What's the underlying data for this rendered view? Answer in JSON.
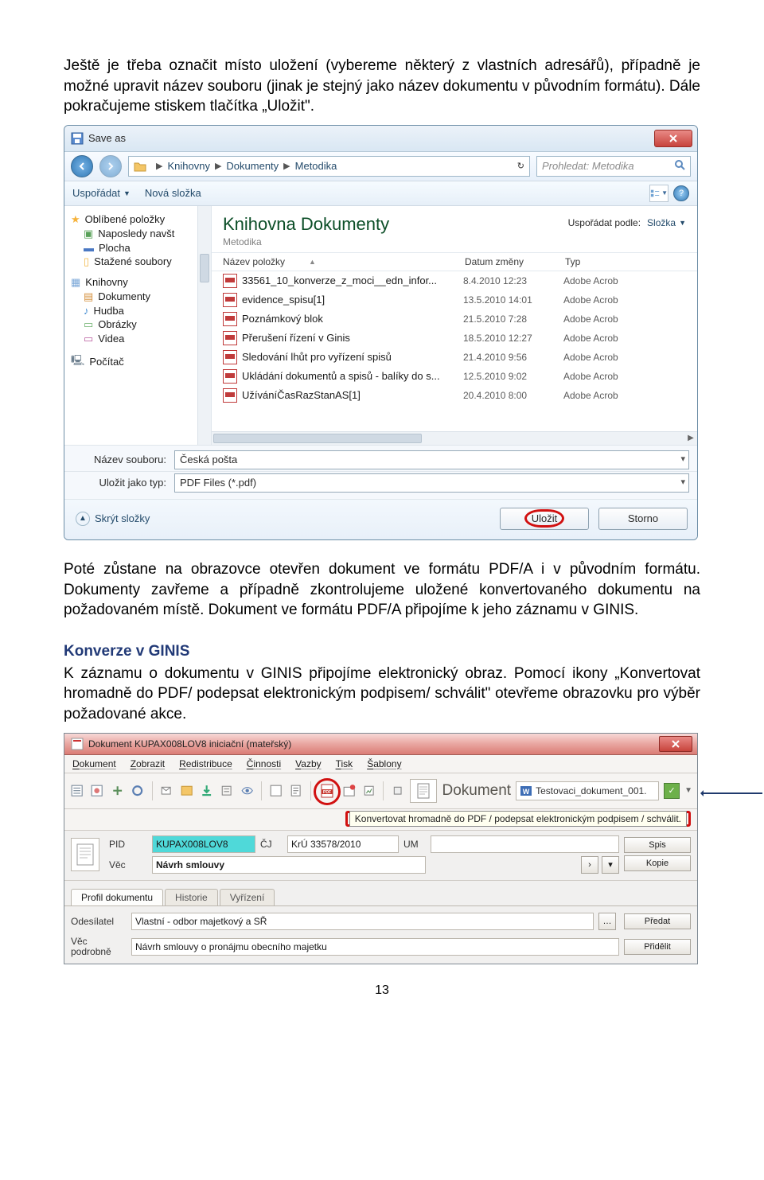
{
  "para1": "Ještě je třeba označit místo uložení (vybereme některý z vlastních adresářů), případně je možné upravit název souboru (jinak je stejný jako název dokumentu v původním formátu). Dále pokračujeme stiskem tlačítka „Uložit\".",
  "saveDialog": {
    "title": "Save as",
    "breadcrumb": [
      "Knihovny",
      "Dokumenty",
      "Metodika"
    ],
    "searchPlaceholder": "Prohledat: Metodika",
    "toolbar": {
      "organize": "Uspořádat",
      "newFolder": "Nová složka"
    },
    "nav": {
      "favorites": {
        "label": "Oblíbené položky",
        "items": [
          "Naposledy navšt",
          "Plocha",
          "Stažené soubory"
        ]
      },
      "libraries": {
        "label": "Knihovny",
        "items": [
          "Dokumenty",
          "Hudba",
          "Obrázky",
          "Videa"
        ]
      },
      "computer": "Počítač"
    },
    "library": {
      "title": "Knihovna Dokumenty",
      "subtitle": "Metodika",
      "sortLabel": "Uspořádat podle:",
      "sortValue": "Složka"
    },
    "columns": {
      "name": "Název položky",
      "date": "Datum změny",
      "type": "Typ"
    },
    "files": [
      {
        "name": "33561_10_konverze_z_moci__edn_infor...",
        "date": "8.4.2010 12:23",
        "type": "Adobe Acrob"
      },
      {
        "name": "evidence_spisu[1]",
        "date": "13.5.2010 14:01",
        "type": "Adobe Acrob"
      },
      {
        "name": "Poznámkový blok",
        "date": "21.5.2010 7:28",
        "type": "Adobe Acrob"
      },
      {
        "name": "Přerušení řízení v Ginis",
        "date": "18.5.2010 12:27",
        "type": "Adobe Acrob"
      },
      {
        "name": "Sledování lhůt pro vyřízení spisů",
        "date": "21.4.2010 9:56",
        "type": "Adobe Acrob"
      },
      {
        "name": "Ukládání dokumentů a spisů - balíky do s...",
        "date": "12.5.2010 9:02",
        "type": "Adobe Acrob"
      },
      {
        "name": "UžíváníČasRazStanAS[1]",
        "date": "20.4.2010 8:00",
        "type": "Adobe Acrob"
      }
    ],
    "filenameLabel": "Název souboru:",
    "filenameValue": "Česká pošta",
    "filetypeLabel": "Uložit jako typ:",
    "filetypeValue": "PDF Files (*.pdf)",
    "hideFolders": "Skrýt složky",
    "saveBtn": "Uložit",
    "cancelBtn": "Storno"
  },
  "para2": "Poté zůstane na obrazovce otevřen dokument ve formátu PDF/A i v původním formátu. Dokumenty zavřeme a případně zkontrolujeme uložené konvertovaného dokumentu na požadovaném místě. Dokument ve formátu PDF/A připojíme k jeho záznamu v GINIS.",
  "heading": "Konverze v GINIS",
  "para3": "K záznamu o dokumentu v GINIS připojíme elektronický obraz. Pomocí ikony „Konvertovat hromadně do PDF/ podepsat elektronickým podpisem/ schválit\" otevřeme obrazovku pro výběr požadované akce.",
  "ginis": {
    "title": "Dokument KUPAX008LOV8 iniciační (mateřský)",
    "menu": [
      "Dokument",
      "Zobrazit",
      "Redistribuce",
      "Činnosti",
      "Vazby",
      "Tisk",
      "Šablony"
    ],
    "docLabel": "Dokument",
    "docField": "Testovaci_dokument_001.",
    "tooltip": "Konvertovat hromadně do PDF / podepsat elektronickým podpisem / schválit.",
    "pidLabel": "PID",
    "pidValue": "KUPAX008LOV8",
    "cjLabel": "ČJ",
    "cjValue": "KrÚ 33578/2010",
    "umLabel": "UM",
    "spisBtn": "Spis",
    "vecLabel": "Věc",
    "vecValue": "Návrh smlouvy",
    "kopieBtn": "Kopie",
    "tabs": [
      "Profil dokumentu",
      "Historie",
      "Vyřízení"
    ],
    "odesilatelLabel": "Odesílatel",
    "odesilatelValue": "Vlastní - odbor majetkový a SŘ",
    "predatBtn": "Předat",
    "vecPodLabel": "Věc podrobně",
    "vecPodValue": "Návrh smlouvy o pronájmu obecního majetku",
    "pridelitBtn": "Přidělit"
  },
  "pageNumber": "13"
}
